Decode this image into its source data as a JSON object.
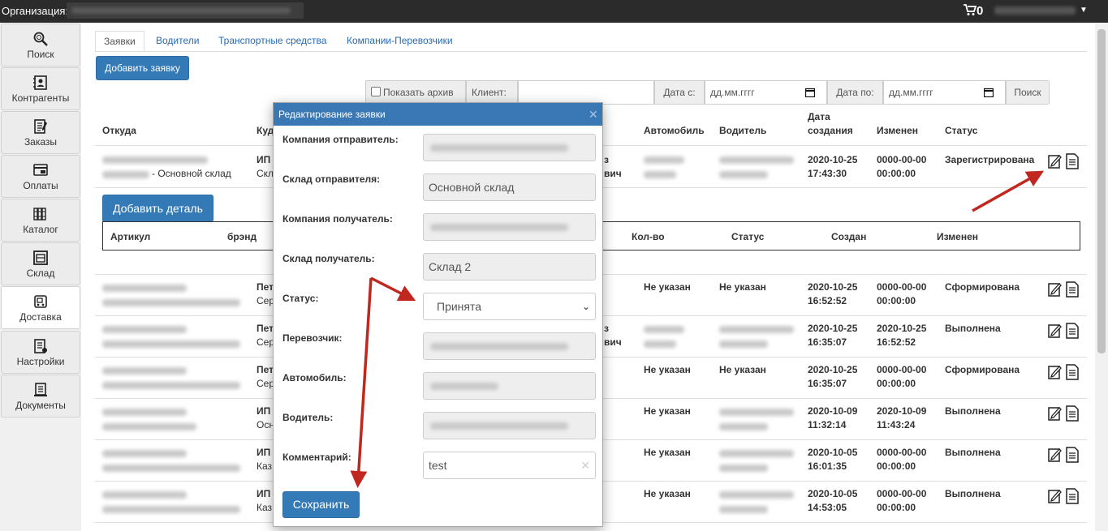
{
  "topbar": {
    "org_label": "Организация:",
    "cart_count": "0"
  },
  "sidebar": {
    "items": [
      {
        "label": "Поиск",
        "icon": "search-icon"
      },
      {
        "label": "Контрагенты",
        "icon": "contacts-icon"
      },
      {
        "label": "Заказы",
        "icon": "orders-icon"
      },
      {
        "label": "Оплаты",
        "icon": "payments-icon"
      },
      {
        "label": "Каталог",
        "icon": "catalog-icon"
      },
      {
        "label": "Склад",
        "icon": "warehouse-icon"
      },
      {
        "label": "Доставка",
        "icon": "delivery-icon",
        "active": true
      },
      {
        "label": "Настройки",
        "icon": "settings-icon"
      },
      {
        "label": "Документы",
        "icon": "documents-icon"
      }
    ]
  },
  "tabs": [
    "Заявки",
    "Водители",
    "Транспортные средства",
    "Компании-Перевозчики"
  ],
  "buttons": {
    "add_request": "Добавить заявку",
    "add_detail": "Добавить деталь",
    "search": "Поиск"
  },
  "filters": {
    "show_archive": "Показать архив",
    "client": "Клиент:",
    "date_from": "Дата с:",
    "date_to": "Дата по:",
    "date_placeholder": "дд.мм.гггг"
  },
  "table": {
    "headers": {
      "from": "Откуда",
      "to": "Куда",
      "car": "Автомобиль",
      "driver": "Водитель",
      "created_1": "Дата",
      "created_2": "создания",
      "changed": "Изменен",
      "status": "Статус"
    },
    "rows": [
      {
        "from_suffix": "- Основной склад",
        "to_1": "ИП",
        "to_2": "Скл",
        "car": "",
        "driver_suffix": "вич",
        "created_1": "2020-10-25",
        "created_2": "17:43:30",
        "changed_1": "0000-00-00",
        "changed_2": "00:00:00",
        "status": "Зарегистрирована"
      },
      {
        "from_suffix": "",
        "to_1": "Пет",
        "to_2": "Сер",
        "car": "Не указан",
        "driver": "Не указан",
        "created_1": "2020-10-25",
        "created_2": "16:52:52",
        "changed_1": "0000-00-00",
        "changed_2": "00:00:00",
        "status": "Сформирована"
      },
      {
        "from_suffix": "",
        "to_1": "Пет",
        "to_2": "Сер",
        "car": "",
        "driver_suffix": "вич",
        "created_1": "2020-10-25",
        "created_2": "16:35:07",
        "changed_1": "2020-10-25",
        "changed_2": "16:52:52",
        "status": "Выполнена"
      },
      {
        "from_suffix": "",
        "to_1": "Пет",
        "to_2": "Сер",
        "car": "Не указан",
        "driver": "Не указан",
        "created_1": "2020-10-25",
        "created_2": "16:35:07",
        "changed_1": "0000-00-00",
        "changed_2": "00:00:00",
        "status": "Сформирована"
      },
      {
        "from_suffix": "",
        "to_1": "ИП",
        "to_2": "Осн",
        "car": "Не указан",
        "driver": "",
        "created_1": "2020-10-09",
        "created_2": "11:32:14",
        "changed_1": "2020-10-09",
        "changed_2": "11:43:24",
        "status": "Выполнена"
      },
      {
        "from_suffix": "",
        "to_1": "ИП",
        "to_2": "Каз",
        "car": "Не указан",
        "driver": "",
        "created_1": "2020-10-05",
        "created_2": "16:01:35",
        "changed_1": "0000-00-00",
        "changed_2": "00:00:00",
        "status": "Выполнена"
      },
      {
        "from_suffix": "",
        "to_1": "ИП",
        "to_2": "Каз",
        "car": "Не указан",
        "driver": "",
        "created_1": "2020-10-05",
        "created_2": "14:53:05",
        "changed_1": "0000-00-00",
        "changed_2": "00:00:00",
        "status": "Выполнена"
      }
    ]
  },
  "detail_table": {
    "headers": [
      "Артикул",
      "брэнд",
      "Кол-во",
      "Статус",
      "Создан",
      "Изменен"
    ]
  },
  "modal": {
    "title": "Редактирование заявки",
    "fields": {
      "sender_company": "Компания отправитель:",
      "sender_warehouse": "Склад отправителя:",
      "sender_warehouse_value": "Основной склад",
      "receiver_company": "Компания получатель:",
      "receiver_warehouse": "Склад получатель:",
      "receiver_warehouse_value": "Склад 2",
      "status": "Статус:",
      "status_value": "Принята",
      "carrier": "Перевозчик:",
      "car": "Автомобиль:",
      "driver": "Водитель:",
      "comment": "Комментарий:",
      "comment_value": "test"
    },
    "save": "Сохранить"
  },
  "colors": {
    "primary": "#337ab7",
    "topbar": "#2b2b2b",
    "arrow": "#c0281f"
  }
}
